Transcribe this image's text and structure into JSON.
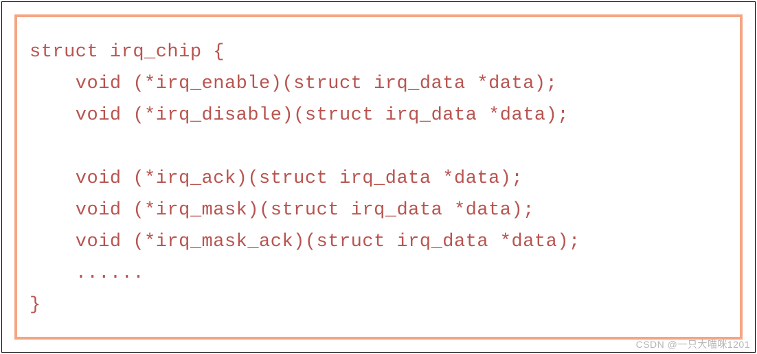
{
  "code": {
    "lines": [
      "struct irq_chip {",
      "    void (*irq_enable)(struct irq_data *data);",
      "    void (*irq_disable)(struct irq_data *data);",
      "",
      "    void (*irq_ack)(struct irq_data *data);",
      "    void (*irq_mask)(struct irq_data *data);",
      "    void (*irq_mask_ack)(struct irq_data *data);",
      "    ......",
      "}"
    ]
  },
  "watermark": "CSDN @一只大喵咪1201"
}
